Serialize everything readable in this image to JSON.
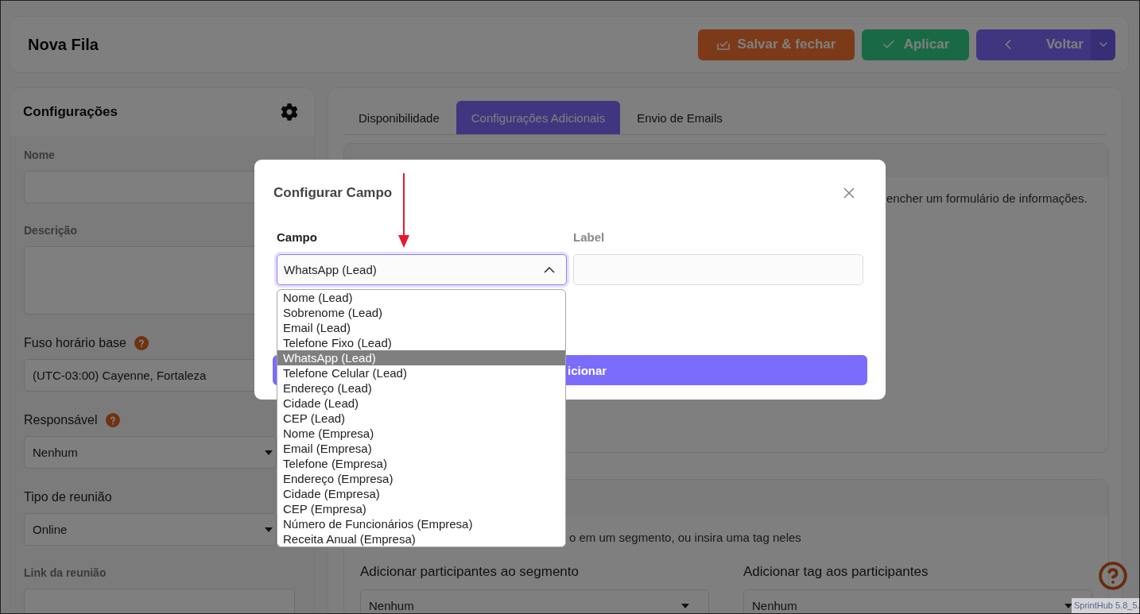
{
  "header": {
    "title": "Nova Fila",
    "buttons": [
      {
        "label": "Salvar & fechar",
        "kind": "save"
      },
      {
        "label": "Aplicar",
        "kind": "apply"
      },
      {
        "label": "Voltar",
        "kind": "back"
      }
    ]
  },
  "settings": {
    "title": "Configurações",
    "fields": [
      {
        "label": "Nome",
        "kind": "input"
      },
      {
        "label": "Descrição",
        "kind": "textarea"
      },
      {
        "label": "Fuso horário base",
        "kind": "picker",
        "value": "(UTC-03:00) Cayenne, Fortaleza",
        "help": true
      },
      {
        "label": "Responsável",
        "kind": "select",
        "value": "Nenhum",
        "help": true
      },
      {
        "label": "Tipo de reunião",
        "kind": "select",
        "value": "Online",
        "help": false
      },
      {
        "label": "Link da reunião",
        "kind": "input"
      }
    ]
  },
  "tabs": [
    {
      "label": "Disponibilidade",
      "selected": false
    },
    {
      "label": "Configurações Adicionais",
      "selected": true
    },
    {
      "label": "Envio de Emails",
      "selected": false
    }
  ],
  "form_card": {
    "text": "encher um formulário de informações."
  },
  "segment_card": {
    "text": "o em um segmento, ou insira uma tag neles",
    "fields": [
      {
        "label": "Adicionar participantes ao segmento",
        "value": "Nenhum"
      },
      {
        "label": "Adicionar tag aos participantes",
        "value": "Nenhum"
      }
    ]
  },
  "modal": {
    "title": "Configurar Campo",
    "campo": {
      "label": "Campo",
      "value": "WhatsApp (Lead)",
      "expanded": true
    },
    "label_field": {
      "label": "Label"
    },
    "button": "icionar",
    "options": [
      {
        "label": "Nome (Lead)",
        "selected": false
      },
      {
        "label": "Sobrenome (Lead)",
        "selected": false
      },
      {
        "label": "Email (Lead)",
        "selected": false
      },
      {
        "label": "Telefone Fixo (Lead)",
        "selected": false
      },
      {
        "label": "WhatsApp (Lead)",
        "selected": true
      },
      {
        "label": "Telefone Celular (Lead)",
        "selected": false
      },
      {
        "label": "Endereço (Lead)",
        "selected": false
      },
      {
        "label": "Cidade (Lead)",
        "selected": false
      },
      {
        "label": "CEP (Lead)",
        "selected": false
      },
      {
        "label": "Nome (Empresa)",
        "selected": false
      },
      {
        "label": "Email (Empresa)",
        "selected": false
      },
      {
        "label": "Telefone (Empresa)",
        "selected": false
      },
      {
        "label": "Endereço (Empresa)",
        "selected": false
      },
      {
        "label": "Cidade (Empresa)",
        "selected": false
      },
      {
        "label": "CEP (Empresa)",
        "selected": false
      },
      {
        "label": "Número de Funcionários (Empresa)",
        "selected": false
      },
      {
        "label": "Receita Anual (Empresa)",
        "selected": false
      }
    ]
  },
  "version": "SprintHub 5.8_5."
}
